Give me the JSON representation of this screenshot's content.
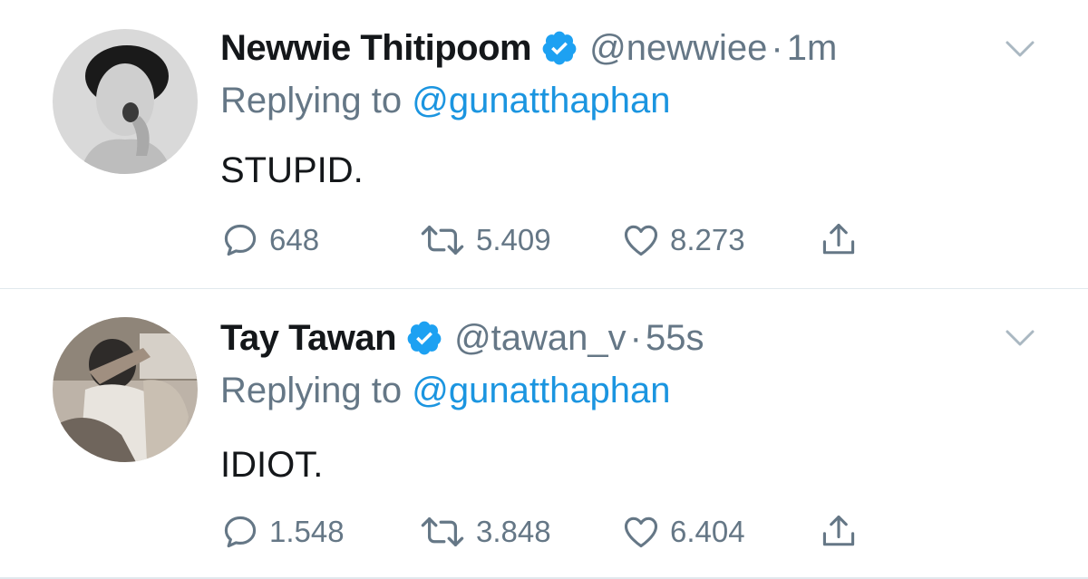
{
  "tweets": [
    {
      "name": "Newwie Thitipoom",
      "handle": "@newwiee",
      "separator": "·",
      "time": "1m",
      "reply_prefix": "Replying to",
      "reply_handle": "@gunatthaphan",
      "text": "STUPID.",
      "replies": "648",
      "retweets": "5.409",
      "likes": "8.273"
    },
    {
      "name": "Tay Tawan",
      "handle": "@tawan_v",
      "separator": "·",
      "time": "55s",
      "reply_prefix": "Replying to",
      "reply_handle": "@gunatthaphan",
      "text": "IDIOT.",
      "replies": "1.548",
      "retweets": "3.848",
      "likes": "6.404"
    }
  ],
  "icons": {
    "verified": "verified-badge-icon",
    "chevron": "chevron-down-icon",
    "reply": "reply-bubble-icon",
    "retweet": "retweet-icon",
    "like": "heart-icon",
    "share": "share-icon"
  },
  "colors": {
    "text": "#14171a",
    "secondary": "#657786",
    "link": "#1b95e0",
    "verified": "#1da1f2",
    "divider": "#e1e8ed"
  }
}
